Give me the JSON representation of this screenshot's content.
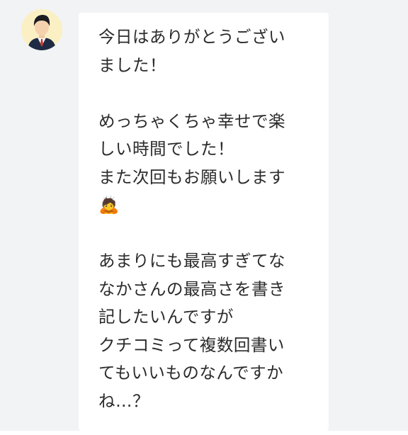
{
  "chat": {
    "sender": {
      "avatar_icon": "user-avatar-businessman-icon",
      "avatar_bg": "#fbf0c4"
    },
    "message": {
      "text_lines": [
        "今日はありがとうござい",
        "ました！",
        "",
        "めっちゃくちゃ幸せで楽",
        "しい時間でした！",
        "また次回もお願いします",
        "🙇",
        "",
        "あまりにも最高すぎてな",
        "なかさんの最高さを書き",
        "記したいんですが",
        "クチコミって複数回書い",
        "てもいいものなんですか",
        "ね…？"
      ],
      "emoji_icon": "bowing-person-emoji"
    }
  },
  "colors": {
    "page_bg": "#f2f3f5",
    "bubble_bg": "#ffffff",
    "text": "#2b2b2b"
  }
}
